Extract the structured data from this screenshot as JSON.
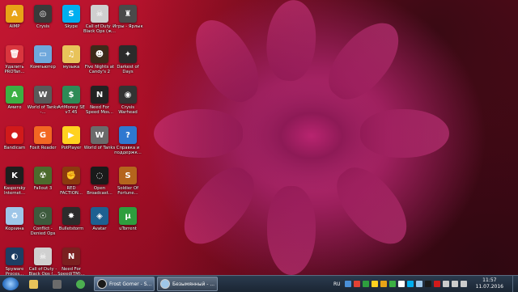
{
  "desktop": {
    "icons": [
      {
        "label": "AIMP",
        "color": "#e8a317",
        "glyph": "A",
        "icon": "aimp-icon"
      },
      {
        "label": "Crysis",
        "color": "#3a3a3a",
        "glyph": "◎",
        "icon": "crysis-icon"
      },
      {
        "label": "Skype",
        "color": "#00aff0",
        "glyph": "S",
        "icon": "skype-icon"
      },
      {
        "label": "Call of Duty - Black Ops (ж...",
        "color": "#cfcfcf",
        "glyph": "☠",
        "icon": "cod-icon"
      },
      {
        "label": "Игры - Ярлык",
        "color": "#4a4a4a",
        "glyph": "♜",
        "icon": "games-folder-icon"
      },
      {
        "label": "Удалить PROTan...",
        "color": "#d9363e",
        "glyph": "🗑",
        "icon": "uninstall-icon"
      },
      {
        "label": "Компьютер",
        "color": "#6fa8dc",
        "glyph": "▭",
        "icon": "computer-icon"
      },
      {
        "label": "музыка",
        "color": "#e8c35a",
        "glyph": "♫",
        "icon": "music-folder-icon"
      },
      {
        "label": "Five Nights at Candy's 2",
        "color": "#3d2a1a",
        "glyph": "☻",
        "icon": "fnac-icon"
      },
      {
        "label": "Darkest of Days",
        "color": "#2b2b2b",
        "glyph": "✦",
        "icon": "darkest-icon"
      },
      {
        "label": "Амиго",
        "color": "#3cb043",
        "glyph": "A",
        "icon": "amigo-icon"
      },
      {
        "label": "World of Tanks -...",
        "color": "#5a5a5a",
        "glyph": "W",
        "icon": "wot-icon"
      },
      {
        "label": "ArtMoney SE v7.45",
        "color": "#2e8b57",
        "glyph": "$",
        "icon": "artmoney-icon"
      },
      {
        "label": "Need For Speed Mos...",
        "color": "#222222",
        "glyph": "N",
        "icon": "nfs-icon"
      },
      {
        "label": "Crysis Warhead",
        "color": "#333333",
        "glyph": "◉",
        "icon": "crysis-warhead-icon"
      },
      {
        "label": "Bandicam",
        "color": "#d11a1a",
        "glyph": "●",
        "icon": "bandicam-icon"
      },
      {
        "label": "Foxit Reader",
        "color": "#f26722",
        "glyph": "G",
        "icon": "foxit-icon"
      },
      {
        "label": "PotPlayer",
        "color": "#ffd21f",
        "glyph": "▶",
        "icon": "potplayer-icon"
      },
      {
        "label": "World of Tanks",
        "color": "#6b6b6b",
        "glyph": "W",
        "icon": "wot2-icon"
      },
      {
        "label": "Справка и поддержк...",
        "color": "#2f78d0",
        "glyph": "?",
        "icon": "help-icon"
      },
      {
        "label": "Kaspersky Internet...",
        "color": "#1e1e1e",
        "glyph": "K",
        "icon": "kaspersky-icon"
      },
      {
        "label": "Fallout 3",
        "color": "#4c6b2d",
        "glyph": "☢",
        "icon": "fallout-icon"
      },
      {
        "label": "RED FACTION...",
        "color": "#8b3a0f",
        "glyph": "✊",
        "icon": "redfaction-icon"
      },
      {
        "label": "Open Broadcast...",
        "color": "#1a1a1a",
        "glyph": "◌",
        "icon": "obs-icon"
      },
      {
        "label": "Soldier Of Fortune...",
        "color": "#b5651d",
        "glyph": "S",
        "icon": "sof-icon"
      },
      {
        "label": "Корзина",
        "color": "#9ec6e8",
        "glyph": "♻",
        "icon": "recycle-bin-icon"
      },
      {
        "label": "Conflict - Denied Ops",
        "color": "#3d5a3d",
        "glyph": "☉",
        "icon": "conflict-icon"
      },
      {
        "label": "Bulletstorm",
        "color": "#2c2c2c",
        "glyph": "✸",
        "icon": "bulletstorm-icon"
      },
      {
        "label": "Avatar",
        "color": "#1e6091",
        "glyph": "◈",
        "icon": "avatar-icon"
      },
      {
        "label": "uTorrent",
        "color": "#2e9e3e",
        "glyph": "µ",
        "icon": "utorrent-icon"
      },
      {
        "label": "Spyware Proces...",
        "color": "#1d3e63",
        "glyph": "◐",
        "icon": "spyware-icon"
      },
      {
        "label": "Call of Duty - Black Ops (...",
        "color": "#d0d0d0",
        "glyph": "☠",
        "icon": "cod2-icon"
      },
      {
        "label": "Need For Speed(TM)...",
        "color": "#7a2020",
        "glyph": "N",
        "icon": "nfs2-icon"
      }
    ]
  },
  "taskbar": {
    "pinned": [
      {
        "icon": "explorer-folder-icon",
        "color": "#e8c35a"
      },
      {
        "icon": "wot-taskbar-icon",
        "color": "#6b6b6b"
      },
      {
        "icon": "chrome-icon",
        "color": "#4caf50"
      }
    ],
    "tasks": [
      {
        "label": "Frost Gomer - S...",
        "icon": "obs-task-icon",
        "active": true
      },
      {
        "label": "Безымянный - ...",
        "icon": "paint-task-icon",
        "active": false
      }
    ],
    "tray": {
      "language": "RU",
      "icons": [
        "#4a90d9",
        "#e34234",
        "#2e9e3e",
        "#ffd21f",
        "#e8a317",
        "#3cb043",
        "#ffffff",
        "#00aff0",
        "#9ec6e8",
        "#1a1a1a",
        "#d11a1a",
        "#cccccc",
        "#cccccc",
        "#cccccc"
      ],
      "time": "11:57",
      "date": "11.07.2016"
    }
  }
}
